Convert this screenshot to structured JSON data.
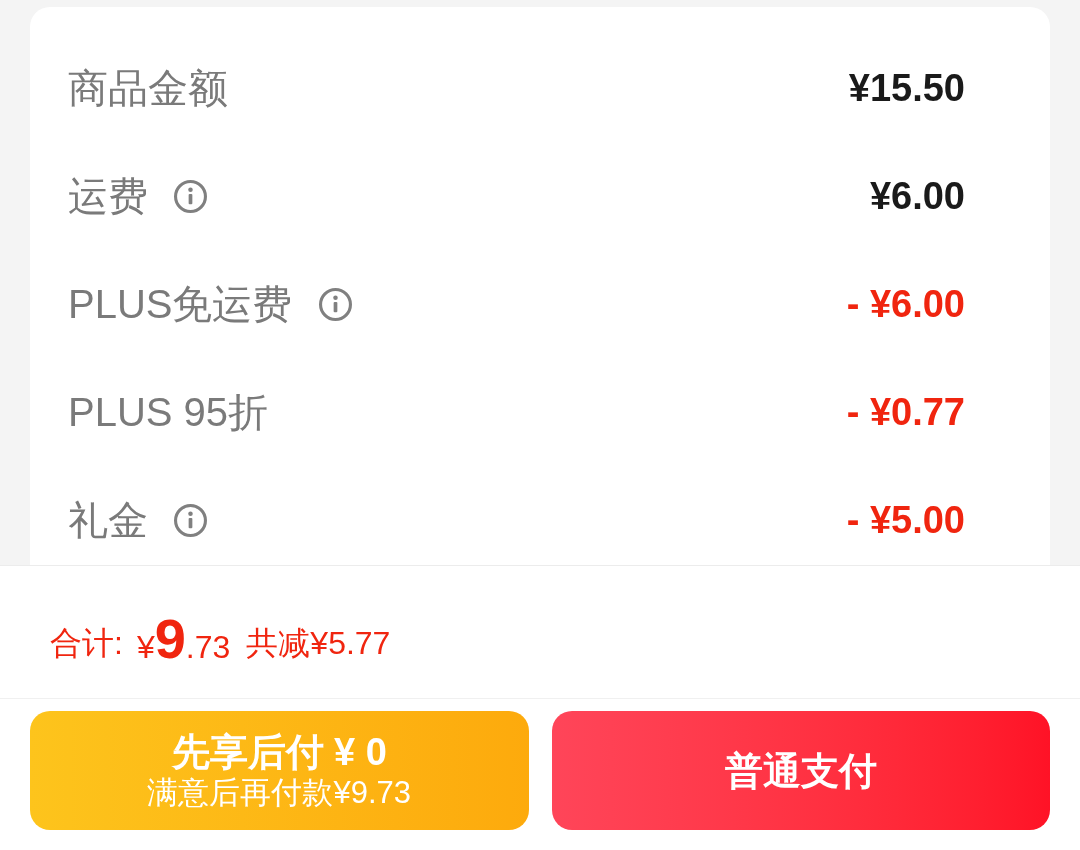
{
  "breakdown": [
    {
      "label": "商品金额",
      "info": false,
      "kind": "plain",
      "amount": "¥15.50"
    },
    {
      "label": "运费",
      "info": true,
      "kind": "plain",
      "amount": "¥6.00"
    },
    {
      "label": "PLUS免运费",
      "info": true,
      "kind": "discount",
      "amount": "- ¥6.00"
    },
    {
      "label": "PLUS 95折",
      "info": false,
      "kind": "discount",
      "amount": "- ¥0.77"
    },
    {
      "label": "礼金",
      "info": true,
      "kind": "discount",
      "amount": "- ¥5.00"
    }
  ],
  "total": {
    "label": "合计:",
    "currency": "¥",
    "integer": "9",
    "decimal": ".73",
    "saved": "共减¥5.77"
  },
  "buttons": [
    {
      "kind": "pay-later",
      "title": "先享后付 ¥ 0",
      "subtitle": "满意后再付款¥9.73"
    },
    {
      "kind": "pay-normal",
      "title": "普通支付"
    }
  ]
}
